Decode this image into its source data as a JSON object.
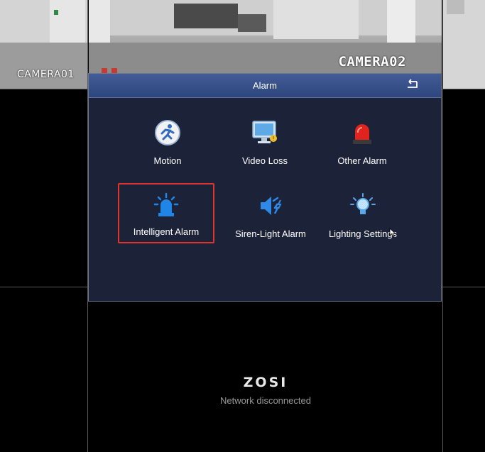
{
  "cameras": [
    {
      "label": "CAMERA01"
    },
    {
      "label": "CAMERA02"
    }
  ],
  "dialog": {
    "title": "Alarm",
    "back_icon": "return-arrow-icon",
    "items": [
      {
        "label": "Motion",
        "icon": "running-man-icon"
      },
      {
        "label": "Video Loss",
        "icon": "monitor-warning-icon"
      },
      {
        "label": "Other Alarm",
        "icon": "red-siren-icon"
      },
      {
        "label": "Intelligent Alarm",
        "icon": "blue-siren-icon",
        "selected": true
      },
      {
        "label": "Siren-Light Alarm",
        "icon": "speaker-bolt-icon"
      },
      {
        "label": "Lighting Settings",
        "icon": "lightbulb-icon"
      }
    ]
  },
  "branding": {
    "logo": "ZOSI"
  },
  "status": {
    "network": "Network disconnected"
  },
  "colors": {
    "selection_border": "#e0342f",
    "dialog_header": "#3a5189",
    "dialog_bg": "#1c2338"
  }
}
